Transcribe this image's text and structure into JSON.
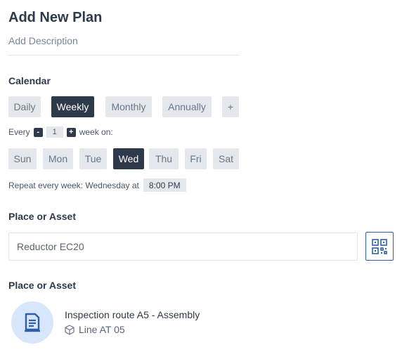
{
  "header": {
    "title": "Add New Plan",
    "description_placeholder": "Add Description"
  },
  "calendar": {
    "label": "Calendar",
    "frequency_tabs": [
      {
        "label": "Daily",
        "active": false
      },
      {
        "label": "Weekly",
        "active": true
      },
      {
        "label": "Monthly",
        "active": false
      },
      {
        "label": "Annually",
        "active": false
      },
      {
        "label": "+",
        "active": false
      }
    ],
    "every_prefix": "Every",
    "decrement_label": "-",
    "interval_value": "1",
    "increment_label": "+",
    "every_suffix": "week on:",
    "days": [
      {
        "label": "Sun",
        "active": false
      },
      {
        "label": "Mon",
        "active": false
      },
      {
        "label": "Tue",
        "active": false
      },
      {
        "label": "Wed",
        "active": true
      },
      {
        "label": "Thu",
        "active": false
      },
      {
        "label": "Fri",
        "active": false
      },
      {
        "label": "Sat",
        "active": false
      }
    ],
    "repeat_text": "Repeat every week: Wednesday at",
    "time_value": "8:00 PM"
  },
  "place_asset": {
    "label": "Place or Asset",
    "input_value": "Reductor EC20",
    "qr_icon": "qr-code-icon"
  },
  "place_asset_selected": {
    "label": "Place or Asset",
    "route_icon": "document-icon",
    "route_title": "Inspection route A5 - Assembly",
    "sub_icon": "cube-icon",
    "route_subtitle": "Line AT 05"
  },
  "colors": {
    "dark": "#2e3a4c",
    "pill": "#e4e8ed",
    "accent_blue": "#2f5fa8",
    "avatar_bg": "#d7e6fb"
  }
}
